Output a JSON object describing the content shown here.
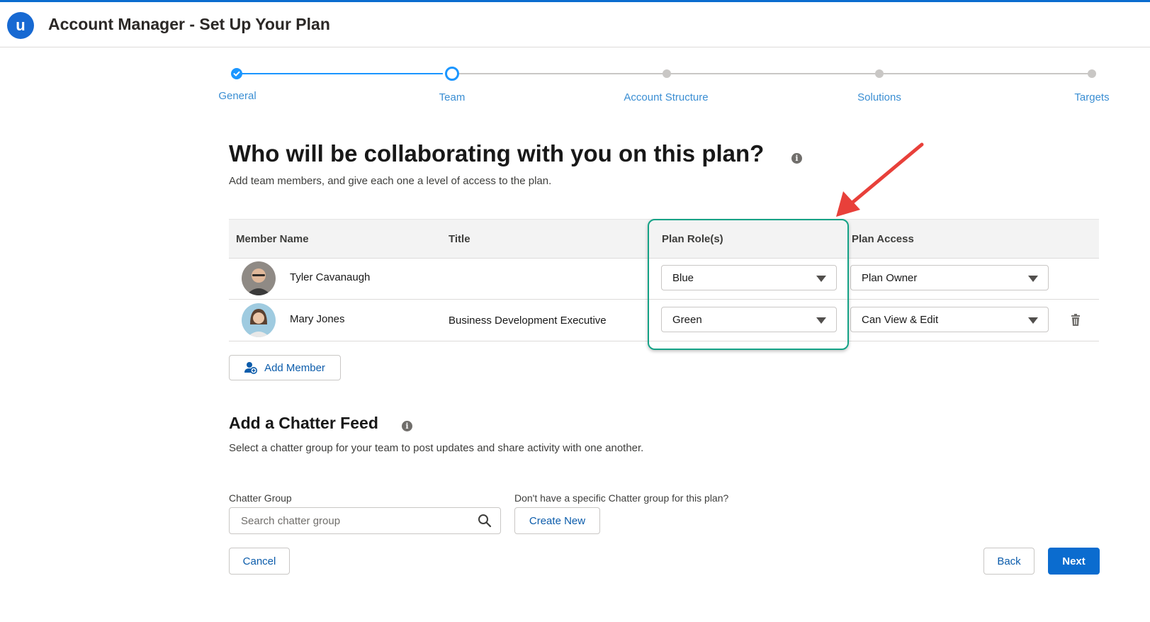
{
  "header": {
    "logo_letter": "u",
    "title": "Account Manager - Set Up Your Plan"
  },
  "stepper": {
    "steps": [
      {
        "label": "General",
        "state": "complete"
      },
      {
        "label": "Team",
        "state": "current"
      },
      {
        "label": "Account Structure",
        "state": "upcoming"
      },
      {
        "label": "Solutions",
        "state": "upcoming"
      },
      {
        "label": "Targets",
        "state": "upcoming"
      }
    ]
  },
  "team": {
    "heading": "Who will be collaborating with you on this plan?",
    "info_glyph": "i",
    "description": "Add team members, and give each one a level of access to the plan.",
    "columns": [
      "Member Name",
      "Title",
      "Plan Role(s)",
      "Plan Access"
    ],
    "members": [
      {
        "name": "Tyler Cavanaugh",
        "title": "",
        "role": "Blue",
        "access": "Plan Owner"
      },
      {
        "name": "Mary Jones",
        "title": "Business Development Executive",
        "role": "Green",
        "access": "Can View & Edit"
      }
    ],
    "add_member_label": "Add Member"
  },
  "chatter": {
    "heading": "Add a Chatter Feed",
    "info_glyph": "i",
    "description": "Select a chatter group for your team to post updates and share activity with one another.",
    "group_label": "Chatter Group",
    "search_placeholder": "Search chatter group",
    "no_group_prompt": "Don't have a specific Chatter group for this plan?",
    "create_new_label": "Create New"
  },
  "footer": {
    "cancel_label": "Cancel",
    "back_label": "Back",
    "next_label": "Next"
  },
  "colors": {
    "brand": "#0b6ccf",
    "highlight": "#14a286",
    "arrow": "#e8403a"
  }
}
